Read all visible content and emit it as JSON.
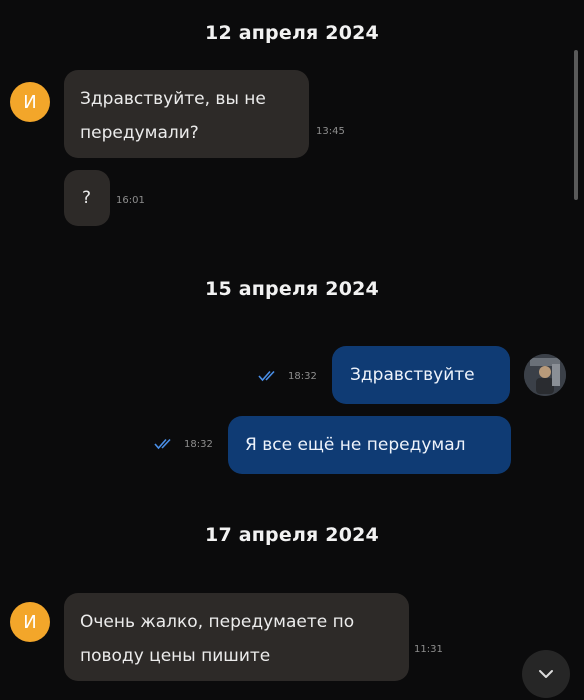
{
  "dates": [
    "12 апреля 2024",
    "15 апреля 2024",
    "17 апреля 2024"
  ],
  "messages": [
    {
      "avatar": "И",
      "line1": "Здравствуйте, вы не",
      "line2": "передумали?",
      "time": "13:45"
    },
    {
      "text": "?",
      "time": "16:01"
    },
    {
      "text": "Здравствуйте",
      "time": "18:32",
      "status": "double-check-icon"
    },
    {
      "text": "Я все ещё не передумал",
      "time": "18:32",
      "status": "double-check-icon"
    },
    {
      "avatar": "И",
      "line1": "Очень жалко, передумаете по",
      "line2": "поводу цены пишите",
      "time": "11:31"
    }
  ],
  "colors": {
    "background": "#0b0b0c",
    "incoming_bubble": "#2d2a28",
    "outgoing_bubble": "#0f3b74",
    "avatar": "#f3a62a",
    "check": "#4a8fe8"
  }
}
